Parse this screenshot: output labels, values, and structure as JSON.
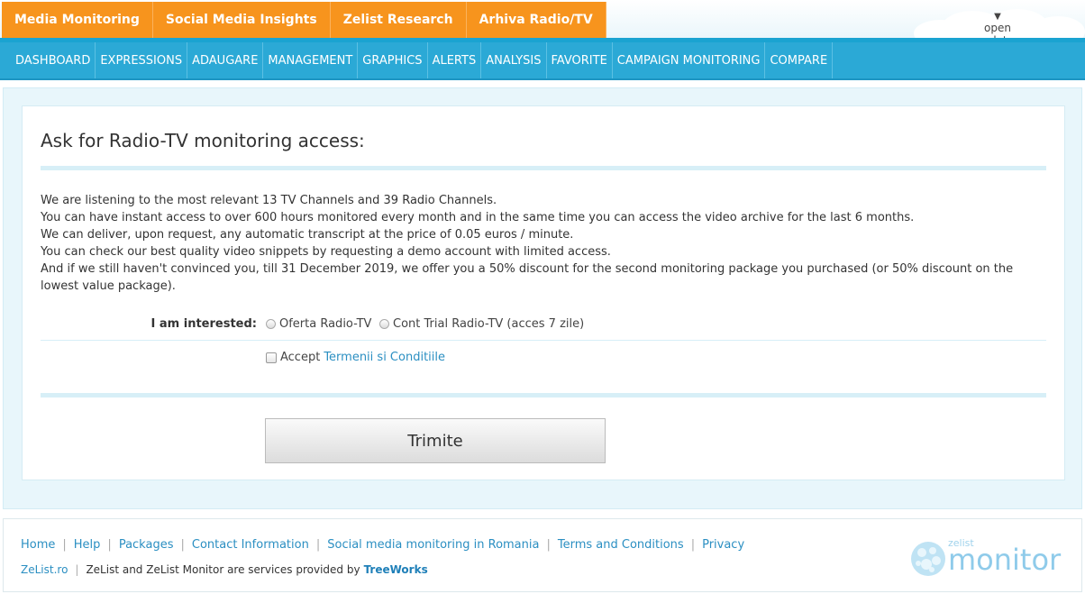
{
  "top_tabs": [
    "Media Monitoring",
    "Social Media Insights",
    "Zelist Research",
    "Arhiva Radio/TV"
  ],
  "open_updates": {
    "arrow": "▼",
    "label": "open updates"
  },
  "nav": [
    "DASHBOARD",
    "EXPRESSIONS",
    "ADAUGARE",
    "MANAGEMENT",
    "GRAPHICS",
    "ALERTS",
    "ANALYSIS",
    "FAVORITE",
    "CAMPAIGN MONITORING",
    "COMPARE"
  ],
  "main": {
    "title": "Ask for  Radio-TV monitoring access:",
    "paragraphs": [
      "We are listening to the most relevant 13 TV Channels and 39  Radio Channels.",
      "You can have instant access to over 600 hours monitored every month and in the same time you can access the video archive for the last 6 months.",
      "We can deliver, upon request, any automatic transcript at the price of 0.05 euros / minute.",
      "You can check our best quality video snippets by requesting a demo account with limited access.",
      "And if we still haven't convinced you, till 31  December 2019, we offer you a 50% discount for the second monitoring package you purchased (or 50% discount on the lowest value package)."
    ],
    "interest_label": "I am interested:",
    "options": [
      "Oferta  Radio-TV",
      "Cont Trial  Radio-TV (acces 7 zile)"
    ],
    "accept_prefix": "Accept",
    "accept_link": "Termenii si Conditiile",
    "submit_label": "Trimite"
  },
  "footer": {
    "links": [
      "Home",
      "Help",
      "Packages",
      "Contact Information",
      "Social media monitoring in Romania",
      "Terms and Conditions",
      "Privacy"
    ],
    "site": "ZeList.ro",
    "provided_text": "ZeList and ZeList  Monitor are services provided by",
    "provider": "TreeWorks",
    "logo_small": "zelist",
    "logo_big": "monitor"
  },
  "colors": {
    "orange": "#f7941d",
    "nav_blue": "#2ba9d6",
    "link_blue": "#2b8fc2"
  }
}
